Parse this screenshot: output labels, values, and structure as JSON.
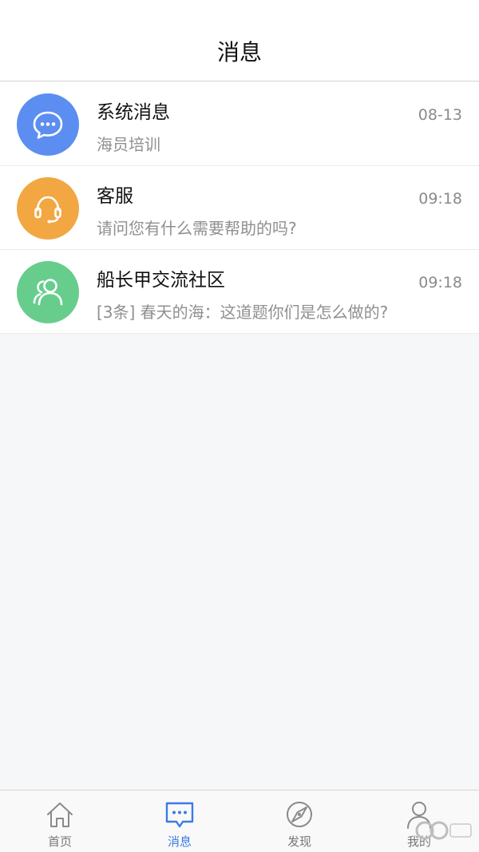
{
  "header": {
    "title": "消息"
  },
  "conversations": [
    {
      "name": "系统消息",
      "time": "08-13",
      "preview": "海员培训",
      "avatar_color": "#5b8ef0",
      "icon": "chat-bubble-icon"
    },
    {
      "name": "客服",
      "time": "09:18",
      "preview": "请问您有什么需要帮助的吗?",
      "avatar_color": "#f2a743",
      "icon": "headset-icon"
    },
    {
      "name": "船长甲交流社区",
      "time": "09:18",
      "preview": "[3条] 春天的海：这道题你们是怎么做的?",
      "avatar_color": "#67cd8c",
      "icon": "group-icon"
    }
  ],
  "tabs": [
    {
      "label": "首页",
      "icon": "home-icon",
      "active": false
    },
    {
      "label": "消息",
      "icon": "message-icon",
      "active": true
    },
    {
      "label": "发现",
      "icon": "compass-icon",
      "active": false
    },
    {
      "label": "我的",
      "icon": "user-icon",
      "active": false
    }
  ],
  "colors": {
    "accent": "#3c7ae6",
    "inactive": "#777777"
  }
}
